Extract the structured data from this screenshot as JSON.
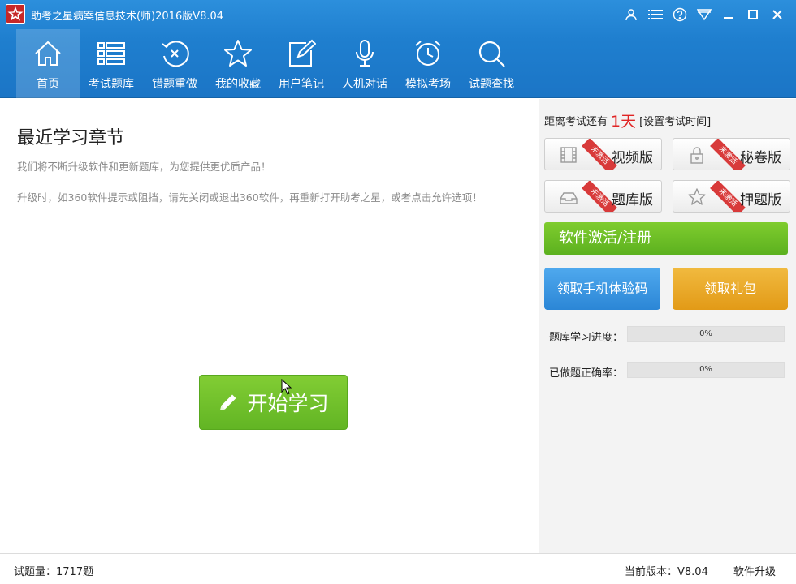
{
  "window": {
    "title": "助考之星病案信息技术(师)2016版V8.04"
  },
  "toolbar": {
    "items": [
      {
        "label": "首页",
        "icon": "home-icon",
        "active": true
      },
      {
        "label": "考试题库",
        "icon": "list-icon"
      },
      {
        "label": "错题重做",
        "icon": "redo-icon"
      },
      {
        "label": "我的收藏",
        "icon": "star-icon"
      },
      {
        "label": "用户笔记",
        "icon": "note-icon"
      },
      {
        "label": "人机对话",
        "icon": "microphone-icon"
      },
      {
        "label": "模拟考场",
        "icon": "alarm-clock-icon"
      },
      {
        "label": "试题查找",
        "icon": "search-icon"
      }
    ]
  },
  "main": {
    "title": "最近学习章节",
    "notice1": "我们将不断升级软件和更新题库，为您提供更优质产品！",
    "notice2": "升级时，如360软件提示或阻挡，请先关闭或退出360软件，再重新打开助考之星，或者点击允许选项！",
    "start_label": "开始学习"
  },
  "sidebar": {
    "countdown_prefix": "距离考试还有",
    "countdown_days": "1天",
    "countdown_link": "[设置考试时间]",
    "editions": [
      {
        "label": "视频版",
        "badge": "未激活",
        "icon": "film-icon"
      },
      {
        "label": "秘卷版",
        "badge": "未激活",
        "icon": "lock-icon"
      },
      {
        "label": "题库版",
        "badge": "未激活",
        "icon": "tray-icon"
      },
      {
        "label": "押题版",
        "badge": "未激活",
        "icon": "star-outline-icon"
      }
    ],
    "activate_label": "软件激活/注册",
    "phone_code_label": "领取手机体验码",
    "gift_label": "领取礼包",
    "progress_label": "题库学习进度：",
    "progress_value": "0%",
    "progress_fraction": 0,
    "accuracy_label": "已做题正确率：",
    "accuracy_value": "0%",
    "accuracy_fraction": 0
  },
  "status": {
    "count": "试题量：1717题",
    "version": "当前版本：V8.04",
    "upgrade": "软件升级"
  },
  "colors": {
    "header_blue": "#1f7fcf",
    "green": "#6cbf2a",
    "blue_button": "#2b86d6",
    "orange_button": "#e29a17",
    "red_badge": "#d83a3a",
    "countdown_red": "#e02424"
  }
}
